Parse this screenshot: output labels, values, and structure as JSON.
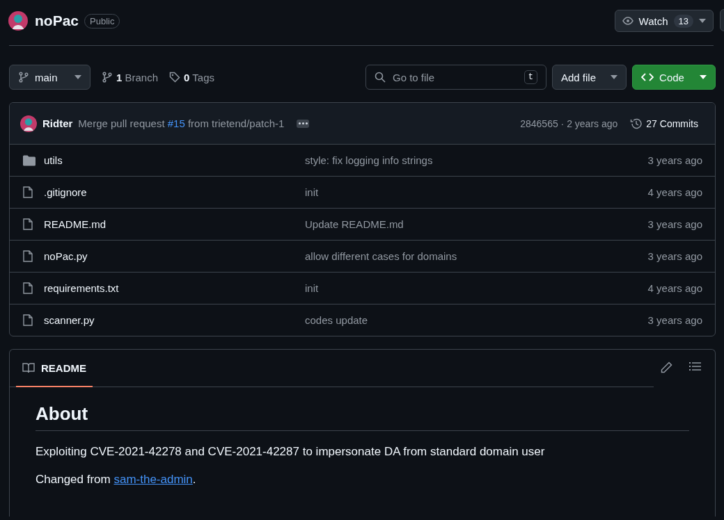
{
  "repo": {
    "name": "noPac",
    "visibility": "Public"
  },
  "watch": {
    "label": "Watch",
    "count": "13"
  },
  "branch": {
    "name": "main"
  },
  "branch_count": {
    "count": "1",
    "label": "Branch"
  },
  "tags": {
    "count": "0",
    "label": "Tags"
  },
  "search": {
    "placeholder": "Go to file",
    "shortcut": "t"
  },
  "add_file": {
    "label": "Add file"
  },
  "code": {
    "label": "Code"
  },
  "latest_commit": {
    "author": "Ridter",
    "message_before": "Merge pull request ",
    "pr": "#15",
    "message_after": " from trietend/patch-1",
    "hash_time": "2846565 · 2 years ago",
    "commits": "27 Commits"
  },
  "files": [
    {
      "kind": "folder",
      "name": "utils",
      "message": "style: fix logging info strings",
      "time": "3 years ago"
    },
    {
      "kind": "file",
      "name": ".gitignore",
      "message": "init",
      "time": "4 years ago"
    },
    {
      "kind": "file",
      "name": "README.md",
      "message": "Update README.md",
      "time": "3 years ago"
    },
    {
      "kind": "file",
      "name": "noPac.py",
      "message": "allow different cases for domains",
      "time": "3 years ago"
    },
    {
      "kind": "file",
      "name": "requirements.txt",
      "message": "init",
      "time": "4 years ago"
    },
    {
      "kind": "file",
      "name": "scanner.py",
      "message": "codes update",
      "time": "3 years ago"
    }
  ],
  "readme": {
    "tab": "README",
    "heading": "About",
    "description": "Exploiting CVE-2021-42278 and CVE-2021-42287 to impersonate DA from standard domain user",
    "changed_prefix": "Changed from ",
    "link": "sam-the-admin",
    "changed_suffix": "."
  }
}
